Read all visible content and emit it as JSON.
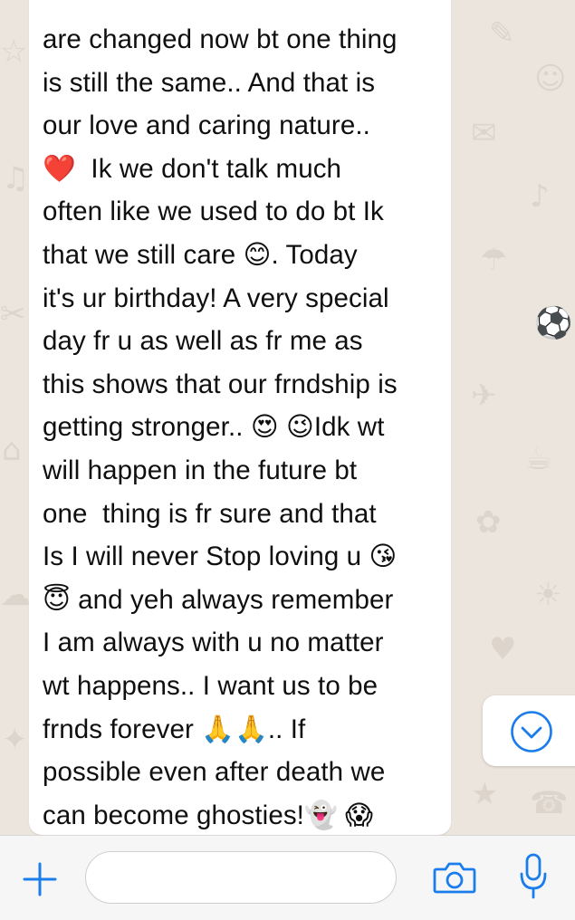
{
  "message": {
    "lines": [
      "are changed now bt one thing",
      "is still the same.. And that is",
      "our love and caring nature..",
      "❤️  Ik we don't talk much",
      "often like we used to do bt Ik",
      "that we still care 😊. Today",
      "it's ur birthday! A very special",
      "day fr u as well as fr me as",
      "this shows that our frndship is",
      "getting stronger.. 😍 😉Idk wt",
      "will happen in the future bt",
      "one  thing is fr sure and that",
      "Is I will never Stop loving u 😘",
      "😇 and yeh always remember",
      "I am always with u no matter",
      "wt happens.. I want us to be",
      "frnds forever 🙏🙏.. If",
      "possible even after death we",
      "can become ghosties!👻 😱"
    ]
  },
  "composer": {
    "placeholder": "",
    "icons": [
      "plus-icon",
      "camera-icon",
      "microphone-icon"
    ]
  },
  "scroll_button": {
    "icon": "chevron-down-icon"
  },
  "colors": {
    "accent": "#1A7DEB",
    "wallpaper": "#ECE5DD",
    "bubble": "#FFFFFF",
    "input_bar": "#F6F6F6"
  }
}
